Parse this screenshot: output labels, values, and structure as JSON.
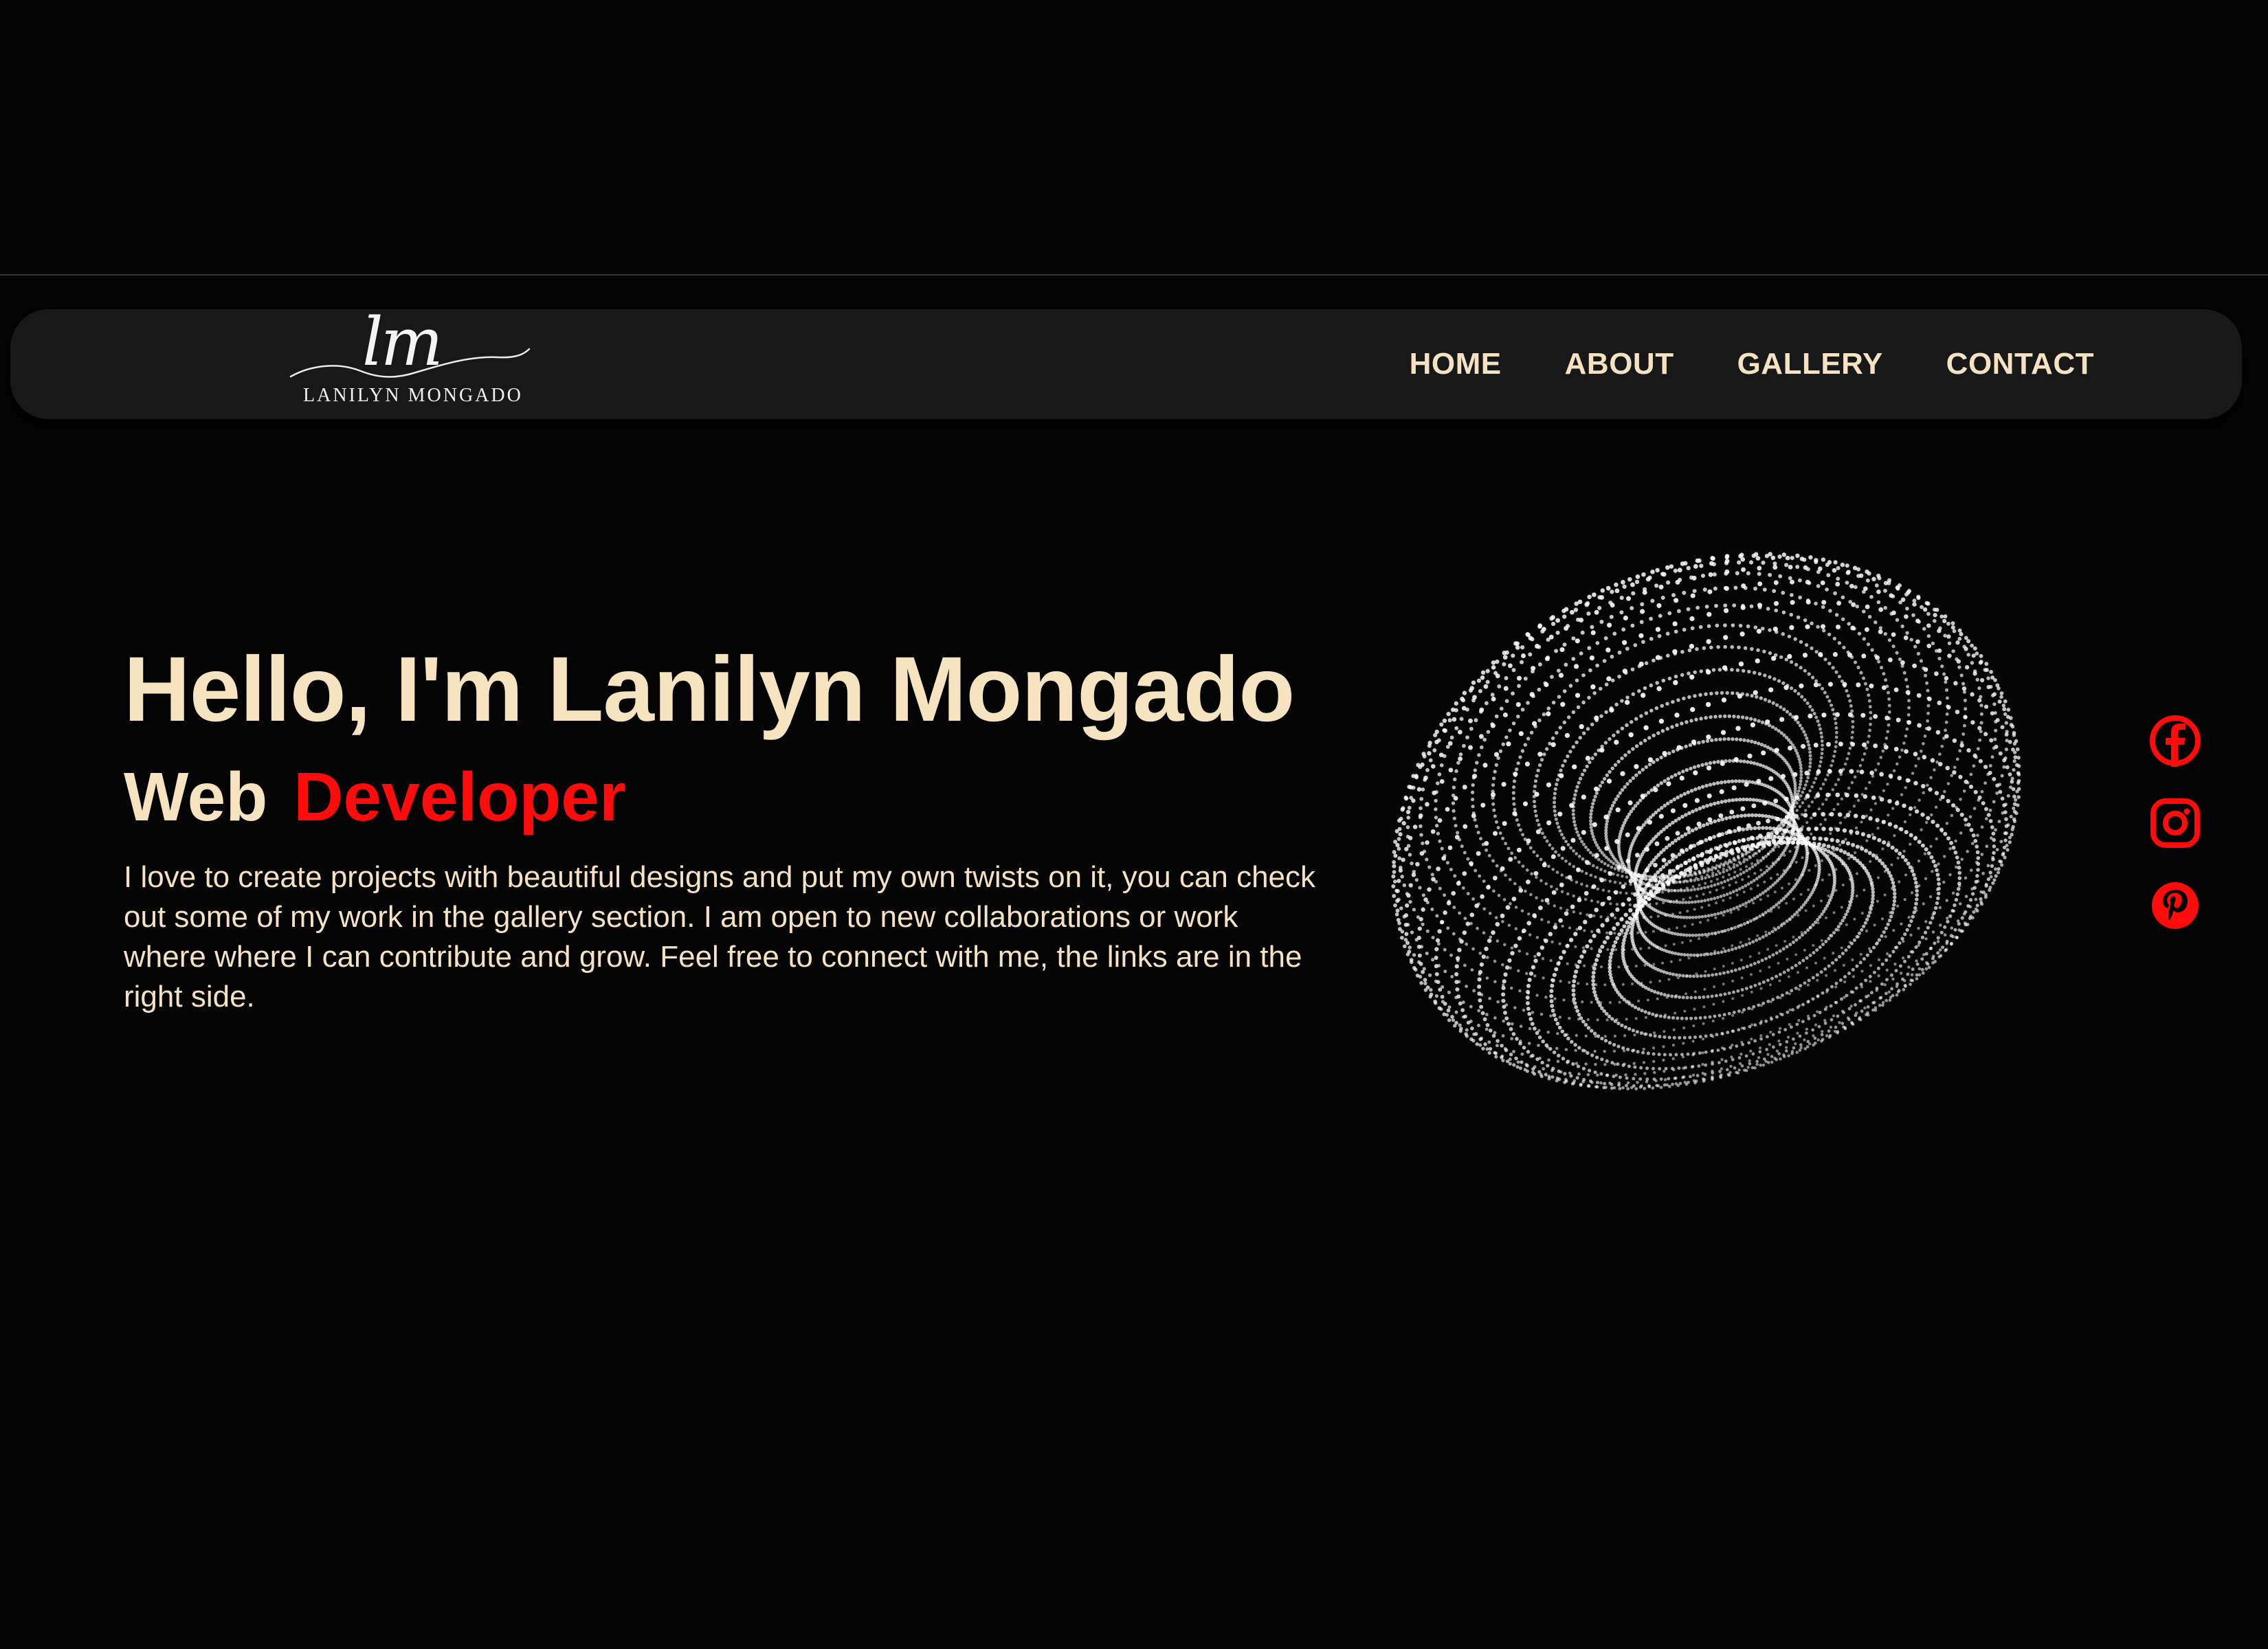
{
  "logo": {
    "monogram": "lm",
    "name": "LANILYN MONGADO"
  },
  "nav": {
    "items": [
      {
        "label": "HOME"
      },
      {
        "label": "ABOUT"
      },
      {
        "label": "GALLERY"
      },
      {
        "label": "CONTACT"
      }
    ]
  },
  "hero": {
    "title": "Hello, I'm Lanilyn Mongado",
    "subtitle_static": "Web",
    "subtitle_role": "Developer",
    "description": "I love to create projects with beautiful designs and put my own twists on it, you can check out some of my work in the gallery section. I am open to new collaborations or work where where I can contribute and grow. Feel free to connect with me, the links are in the right side."
  },
  "graphic": {
    "icon": "dotted-torus-illustration"
  },
  "social": {
    "links": [
      {
        "icon": "facebook-icon"
      },
      {
        "icon": "instagram-icon"
      },
      {
        "icon": "pinterest-icon"
      }
    ]
  },
  "colors": {
    "background": "#040404",
    "navbar": "#181818",
    "text_cream": "#f6e3c0",
    "accent_red": "#ff0b0b"
  }
}
